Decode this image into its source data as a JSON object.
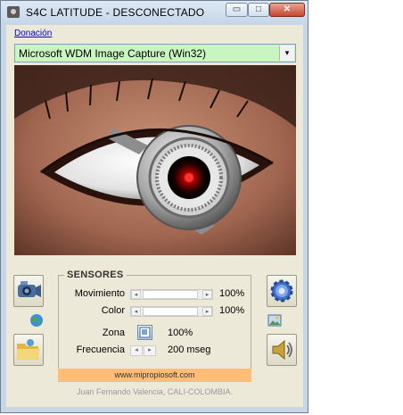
{
  "window": {
    "title": "S4C LATITUDE  -  DESCONECTADO",
    "minimize_glyph": "▭",
    "maximize_glyph": "□",
    "close_glyph": "✕"
  },
  "donation_link": "Donación",
  "device_select": {
    "selected": "Microsoft WDM Image Capture (Win32)",
    "arrow": "▾"
  },
  "sensors": {
    "title": "SENSORES",
    "movement": {
      "label": "Movimiento",
      "value": "100%",
      "level": 1.0
    },
    "color": {
      "label": "Color",
      "value": "100%",
      "level": 1.0
    },
    "zone": {
      "label": "Zona",
      "value": "100%"
    },
    "frequency": {
      "label": "Frecuencia",
      "value": "200 mseg"
    }
  },
  "buttons": {
    "left_top_icon": "camcorder-icon",
    "left_bottom_icon": "open-folder-icon",
    "right_top_icon": "gear-icon",
    "right_bottom_icon": "speaker-icon",
    "left_small_icon": "globe-icon",
    "right_small_icon": "picture-icon"
  },
  "banner_text": "www.mipropiosoft.com",
  "credit": "Juan Fernando Valencia, CALI-COLOMBIA.",
  "colors": {
    "combo_bg": "#c8f5c0",
    "banner_bg": "#ffbd77",
    "window_bg": "#ece9d8"
  }
}
